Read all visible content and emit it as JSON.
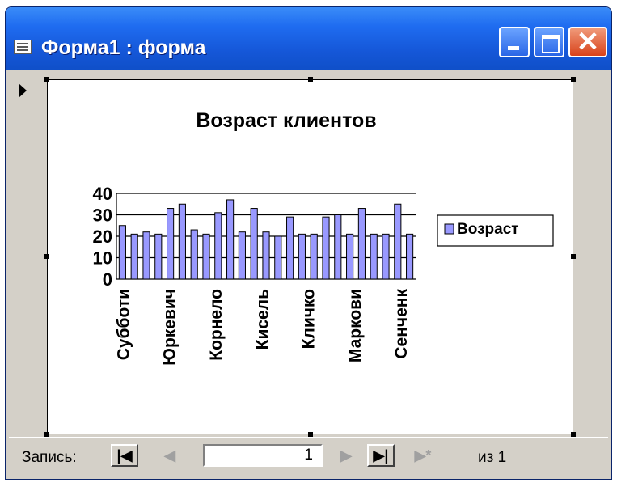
{
  "window": {
    "title": "Форма1 : форма",
    "icon": "form-icon",
    "close_glyph": "✕"
  },
  "chart_data": {
    "type": "bar",
    "title": "Возраст клиентов",
    "ylim": [
      0,
      40
    ],
    "yticks": [
      0,
      10,
      20,
      30,
      40
    ],
    "grid": true,
    "legend_position": "right",
    "categories": [
      "Субботи",
      "",
      "",
      "",
      "",
      "Юркевич",
      "",
      "",
      "",
      "",
      "Корнело",
      "",
      "",
      "",
      "",
      "Кисель",
      "",
      "",
      "",
      "",
      "Кличко",
      "",
      "",
      "",
      "",
      "Маркови",
      "",
      "",
      "",
      "",
      "Сенченк",
      ""
    ],
    "tick_labels": [
      "Субботи",
      "Юркевич",
      "Корнело",
      "Кисель",
      "Кличко",
      "Маркови",
      "Сенченк"
    ],
    "series": [
      {
        "name": "Возраст",
        "color": "#9999ff",
        "values": [
          25,
          21,
          22,
          21,
          33,
          35,
          23,
          21,
          31,
          37,
          22,
          33,
          22,
          20,
          29,
          21,
          21,
          29,
          30,
          21,
          33,
          21,
          21,
          35,
          21
        ]
      }
    ]
  },
  "navigation": {
    "label": "Запись:",
    "first_glyph": "|◀",
    "prev_glyph": "◀",
    "current_record": "1",
    "next_glyph": "▶",
    "last_glyph": "▶|",
    "new_glyph": "▶*",
    "of_text": "из 1"
  }
}
